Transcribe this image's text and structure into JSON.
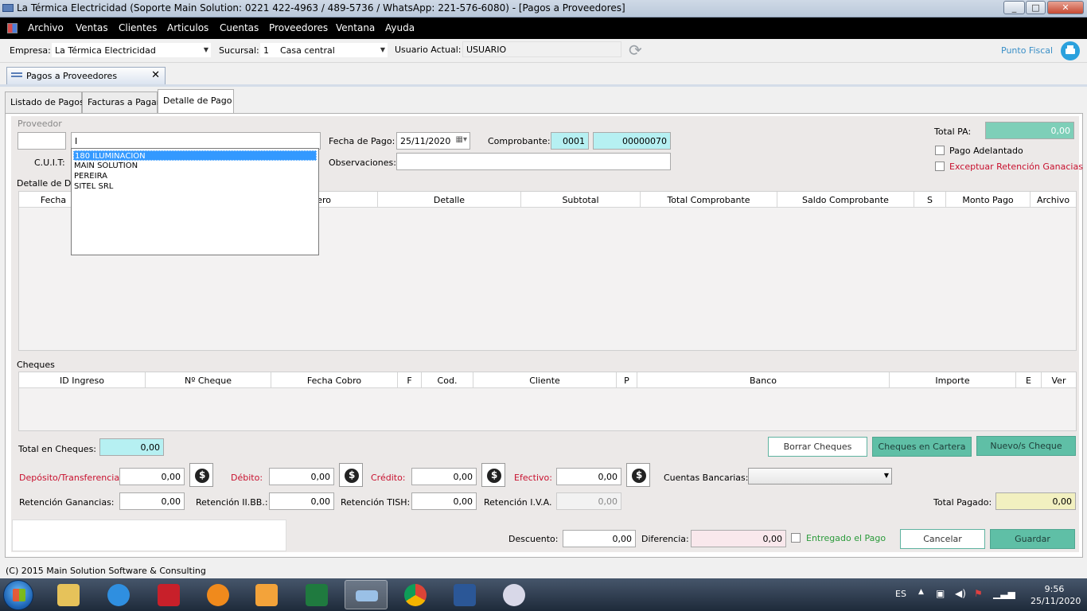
{
  "window": {
    "title": "La Térmica Electricidad (Soporte Main Solution: 0221 422-4963 / 489-5736 / WhatsApp: 221-576-6080) - [Pagos a Proveedores]",
    "minimize": "_",
    "maximize": "□",
    "close": "✕"
  },
  "menu": [
    "Archivo",
    "Ventas",
    "Clientes",
    "Articulos",
    "Cuentas",
    "Proveedores",
    "Ventana",
    "Ayuda"
  ],
  "toolbar": {
    "empresa_label": "Empresa:",
    "empresa_value": "La Térmica Electricidad",
    "sucursal_label": "Sucursal:",
    "sucursal_value": "1    Casa central",
    "usuario_label": "Usuario Actual:",
    "usuario_value": "USUARIO",
    "punto_fiscal": "Punto Fiscal"
  },
  "doc_tab": {
    "label": "Pagos a Proveedores",
    "close": "✕"
  },
  "tabs": [
    "Listado de Pagos",
    "Facturas a Pagar",
    "Detalle de Pago"
  ],
  "proveedor": {
    "group_label": "Proveedor",
    "code_value": "",
    "name_value": "I",
    "cuit_label": "C.U.I.T:",
    "dropdown_options": [
      "180 ILUMINACION",
      "MAIN SOLUTION",
      "PEREIRA",
      "SITEL SRL"
    ]
  },
  "fecha_pago": {
    "label": "Fecha de Pago:",
    "value": "25/11/2020"
  },
  "comprobante": {
    "label": "Comprobante:",
    "punto": "0001",
    "numero": "00000070"
  },
  "observaciones": {
    "label": "Observaciones:",
    "value": ""
  },
  "total_pa": {
    "label": "Total PA:",
    "value": "0,00"
  },
  "checks": {
    "pago_adelantado": "Pago Adelantado",
    "exceptuar": "Exceptuar Retención Ganacias"
  },
  "detalle_deuda": {
    "label": "Detalle de Deu",
    "columns": [
      "Fecha",
      "ero",
      "Detalle",
      "Subtotal",
      "Total Comprobante",
      "Saldo Comprobante",
      "S",
      "Monto Pago",
      "Archivo"
    ]
  },
  "cheques": {
    "label": "Cheques",
    "columns": [
      "ID Ingreso",
      "Nº Cheque",
      "Fecha Cobro",
      "F",
      "Cod.",
      "Cliente",
      "P",
      "Banco",
      "Importe",
      "E",
      "Ver"
    ],
    "total_label": "Total en Cheques:",
    "total_value": "0,00",
    "btn_borrar": "Borrar Cheques",
    "btn_cartera": "Cheques en Cartera",
    "btn_nuevo": "Nuevo/s Cheque"
  },
  "pagos": {
    "deposito_label": "Depósito/Transferencia:",
    "deposito_value": "0,00",
    "debito_label": "Débito:",
    "debito_value": "0,00",
    "credito_label": "Crédito:",
    "credito_value": "0,00",
    "efectivo_label": "Efectivo:",
    "efectivo_value": "0,00",
    "cuentas_label": "Cuentas Bancarias:",
    "cuentas_value": "",
    "ret_gan_label": "Retención Ganancias:",
    "ret_gan_value": "0,00",
    "ret_iibb_label": "Retención II.BB.:",
    "ret_iibb_value": "0,00",
    "ret_tish_label": "Retención TISH:",
    "ret_tish_value": "0,00",
    "ret_iva_label": "Retención I.V.A.",
    "ret_iva_value": "0,00",
    "total_pagado_label": "Total Pagado:",
    "total_pagado_value": "0,00"
  },
  "footer": {
    "descuento_label": "Descuento:",
    "descuento_value": "0,00",
    "diferencia_label": "Diferencia:",
    "diferencia_value": "0,00",
    "entregado_label": "Entregado el Pago",
    "btn_cancelar": "Cancelar",
    "btn_guardar": "Guardar"
  },
  "status": "(C) 2015 Main Solution Software & Consulting",
  "taskbar": {
    "apps": [
      "explorer-icon",
      "ie-icon",
      "autocad-icon",
      "vlc-like-icon",
      "media-player-icon",
      "excel-icon",
      "main-solution-icon",
      "chrome-icon",
      "word-icon",
      "snipping-icon"
    ],
    "lang": "ES",
    "time": "9:56",
    "date": "25/11/2020"
  }
}
